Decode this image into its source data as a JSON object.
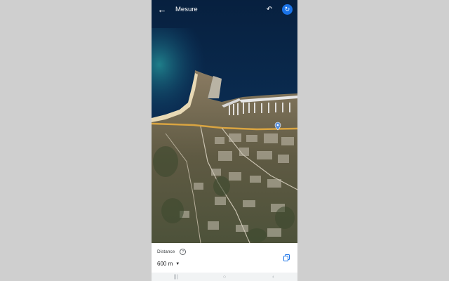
{
  "header": {
    "title": "Mesure",
    "back_icon": "arrow-left-icon",
    "undo_icon": "undo-icon",
    "clear_icon": "refresh-icon"
  },
  "map": {
    "type": "satellite"
  },
  "sheet": {
    "distance_label": "Distance",
    "help_icon": "help-circle-icon",
    "distance_value": "600 m",
    "unit_dropdown_icon": "caret-down-icon",
    "copy_icon": "copy-icon"
  },
  "nav_bar": {
    "items": [
      "recent-apps-icon",
      "home-icon",
      "back-nav-icon"
    ]
  },
  "colors": {
    "accent": "#1a73e8",
    "sea": "#0b2a52",
    "background": "#cfcfcf"
  }
}
